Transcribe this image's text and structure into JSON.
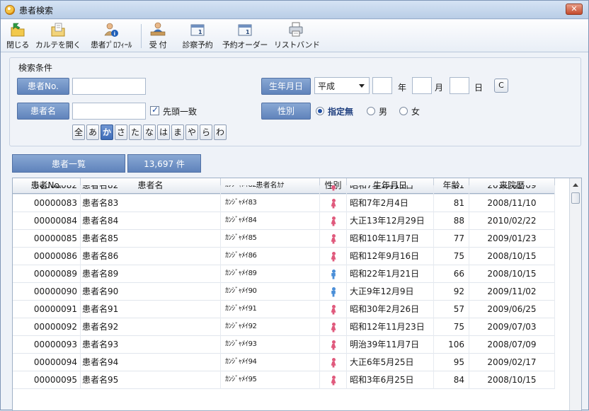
{
  "window": {
    "title": "患者検索",
    "close_label": "✕"
  },
  "toolbar": {
    "items": [
      {
        "label": "閉じる"
      },
      {
        "label": "カルテを開く"
      },
      {
        "label": "患者ﾌﾟﾛﾌｨｰﾙ"
      },
      {
        "label": "受 付"
      },
      {
        "label": "診察予約"
      },
      {
        "label": "予約オーダー"
      },
      {
        "label": "リストバンド"
      }
    ]
  },
  "search": {
    "title": "検索条件",
    "patient_no_label": "患者No.",
    "patient_no_value": "",
    "patient_name_label": "患者名",
    "patient_name_value": "",
    "prefix_match_label": "先頭一致",
    "prefix_match_checked": true,
    "birthdate_label": "生年月日",
    "era_selected": "平成",
    "year_unit": "年",
    "month_unit": "月",
    "day_unit": "日",
    "clear_label": "C",
    "sex_label": "性別",
    "sex_options": [
      "指定無",
      "男",
      "女"
    ],
    "sex_selected": "指定無",
    "kana_buttons": [
      "全",
      "あ",
      "か",
      "さ",
      "た",
      "な",
      "は",
      "ま",
      "や",
      "ら",
      "わ"
    ],
    "kana_active": "か"
  },
  "list": {
    "title": "患者一覧",
    "count": "13,697 件",
    "columns": [
      "患者No.",
      "患者名",
      "患者名ｶﾅ",
      "性別",
      "生年月日",
      "年齢",
      "来院歴"
    ],
    "partial_row": {
      "no": "00000082",
      "name": "患者名82",
      "kana": "ｶﾝｼﾞｬﾒｲ82",
      "sex": "female",
      "birth": "昭和7年1月11日",
      "age": "81",
      "visit": "2012/02/09"
    },
    "rows": [
      {
        "no": "00000083",
        "name": "患者名83",
        "kana": "ｶﾝｼﾞｬﾒｲ83",
        "sex": "female",
        "birth": "昭和7年2月4日",
        "age": "81",
        "visit": "2008/11/10"
      },
      {
        "no": "00000084",
        "name": "患者名84",
        "kana": "ｶﾝｼﾞｬﾒｲ84",
        "sex": "female",
        "birth": "大正13年12月29日",
        "age": "88",
        "visit": "2010/02/22"
      },
      {
        "no": "00000085",
        "name": "患者名85",
        "kana": "ｶﾝｼﾞｬﾒｲ85",
        "sex": "female",
        "birth": "昭和10年11月7日",
        "age": "77",
        "visit": "2009/01/23"
      },
      {
        "no": "00000086",
        "name": "患者名86",
        "kana": "ｶﾝｼﾞｬﾒｲ86",
        "sex": "female",
        "birth": "昭和12年9月16日",
        "age": "75",
        "visit": "2008/10/15"
      },
      {
        "no": "00000089",
        "name": "患者名89",
        "kana": "ｶﾝｼﾞｬﾒｲ89",
        "sex": "male",
        "birth": "昭和22年1月21日",
        "age": "66",
        "visit": "2008/10/15"
      },
      {
        "no": "00000090",
        "name": "患者名90",
        "kana": "ｶﾝｼﾞｬﾒｲ90",
        "sex": "male",
        "birth": "大正9年12月9日",
        "age": "92",
        "visit": "2009/11/02"
      },
      {
        "no": "00000091",
        "name": "患者名91",
        "kana": "ｶﾝｼﾞｬﾒｲ91",
        "sex": "female",
        "birth": "昭和30年2月26日",
        "age": "57",
        "visit": "2009/06/25"
      },
      {
        "no": "00000092",
        "name": "患者名92",
        "kana": "ｶﾝｼﾞｬﾒｲ92",
        "sex": "female",
        "birth": "昭和12年11月23日",
        "age": "75",
        "visit": "2009/07/03"
      },
      {
        "no": "00000093",
        "name": "患者名93",
        "kana": "ｶﾝｼﾞｬﾒｲ93",
        "sex": "female",
        "birth": "明治39年11月7日",
        "age": "106",
        "visit": "2008/07/09"
      },
      {
        "no": "00000094",
        "name": "患者名94",
        "kana": "ｶﾝｼﾞｬﾒｲ94",
        "sex": "female",
        "birth": "大正6年5月25日",
        "age": "95",
        "visit": "2009/02/17"
      },
      {
        "no": "00000095",
        "name": "患者名95",
        "kana": "ｶﾝｼﾞｬﾒｲ95",
        "sex": "female",
        "birth": "昭和3年6月25日",
        "age": "84",
        "visit": "2008/10/15"
      }
    ]
  },
  "colors": {
    "label_blue": "#5f83bb",
    "female": "#e05a7d",
    "male": "#4b8fd8",
    "radio_on": "#1f4ea3"
  }
}
